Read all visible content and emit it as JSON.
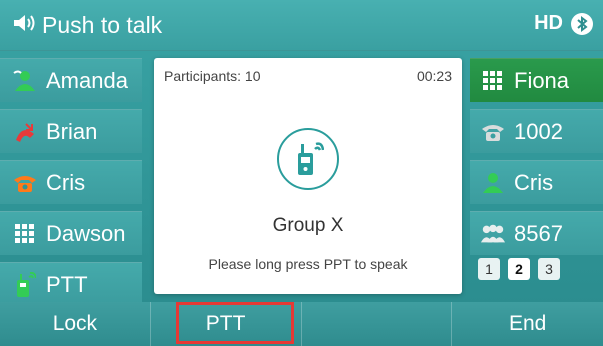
{
  "header": {
    "title": "Push to talk",
    "hd_label": "HD",
    "icons": [
      "speaker-icon",
      "bluetooth-icon"
    ]
  },
  "left_keys": [
    {
      "label": "Amanda",
      "icon": "contact-online-icon"
    },
    {
      "label": "Brian",
      "icon": "missed-call-icon"
    },
    {
      "label": "Cris",
      "icon": "handset-orange-icon"
    },
    {
      "label": "Dawson",
      "icon": "dialpad-icon"
    },
    {
      "label": "PTT",
      "icon": "walkie-talkie-icon"
    }
  ],
  "right_keys": [
    {
      "label": "Fiona",
      "icon": "dialpad-icon",
      "active": true
    },
    {
      "label": "1002",
      "icon": "phone-gray-icon"
    },
    {
      "label": "Cris",
      "icon": "contact-online-icon"
    },
    {
      "label": "8567",
      "icon": "group-icon"
    }
  ],
  "pager": [
    "1",
    "2",
    "3"
  ],
  "pager_current": "2",
  "panel": {
    "participants": "Participants: 10",
    "timer": "00:23",
    "group_name": "Group X",
    "hint": "Please long press PPT to speak"
  },
  "softkeys": [
    "Lock",
    "PTT",
    "",
    "End"
  ],
  "colors": {
    "teal": "#3aa4a5",
    "active_green": "#2a9a4c",
    "highlight_red": "#e53935"
  }
}
